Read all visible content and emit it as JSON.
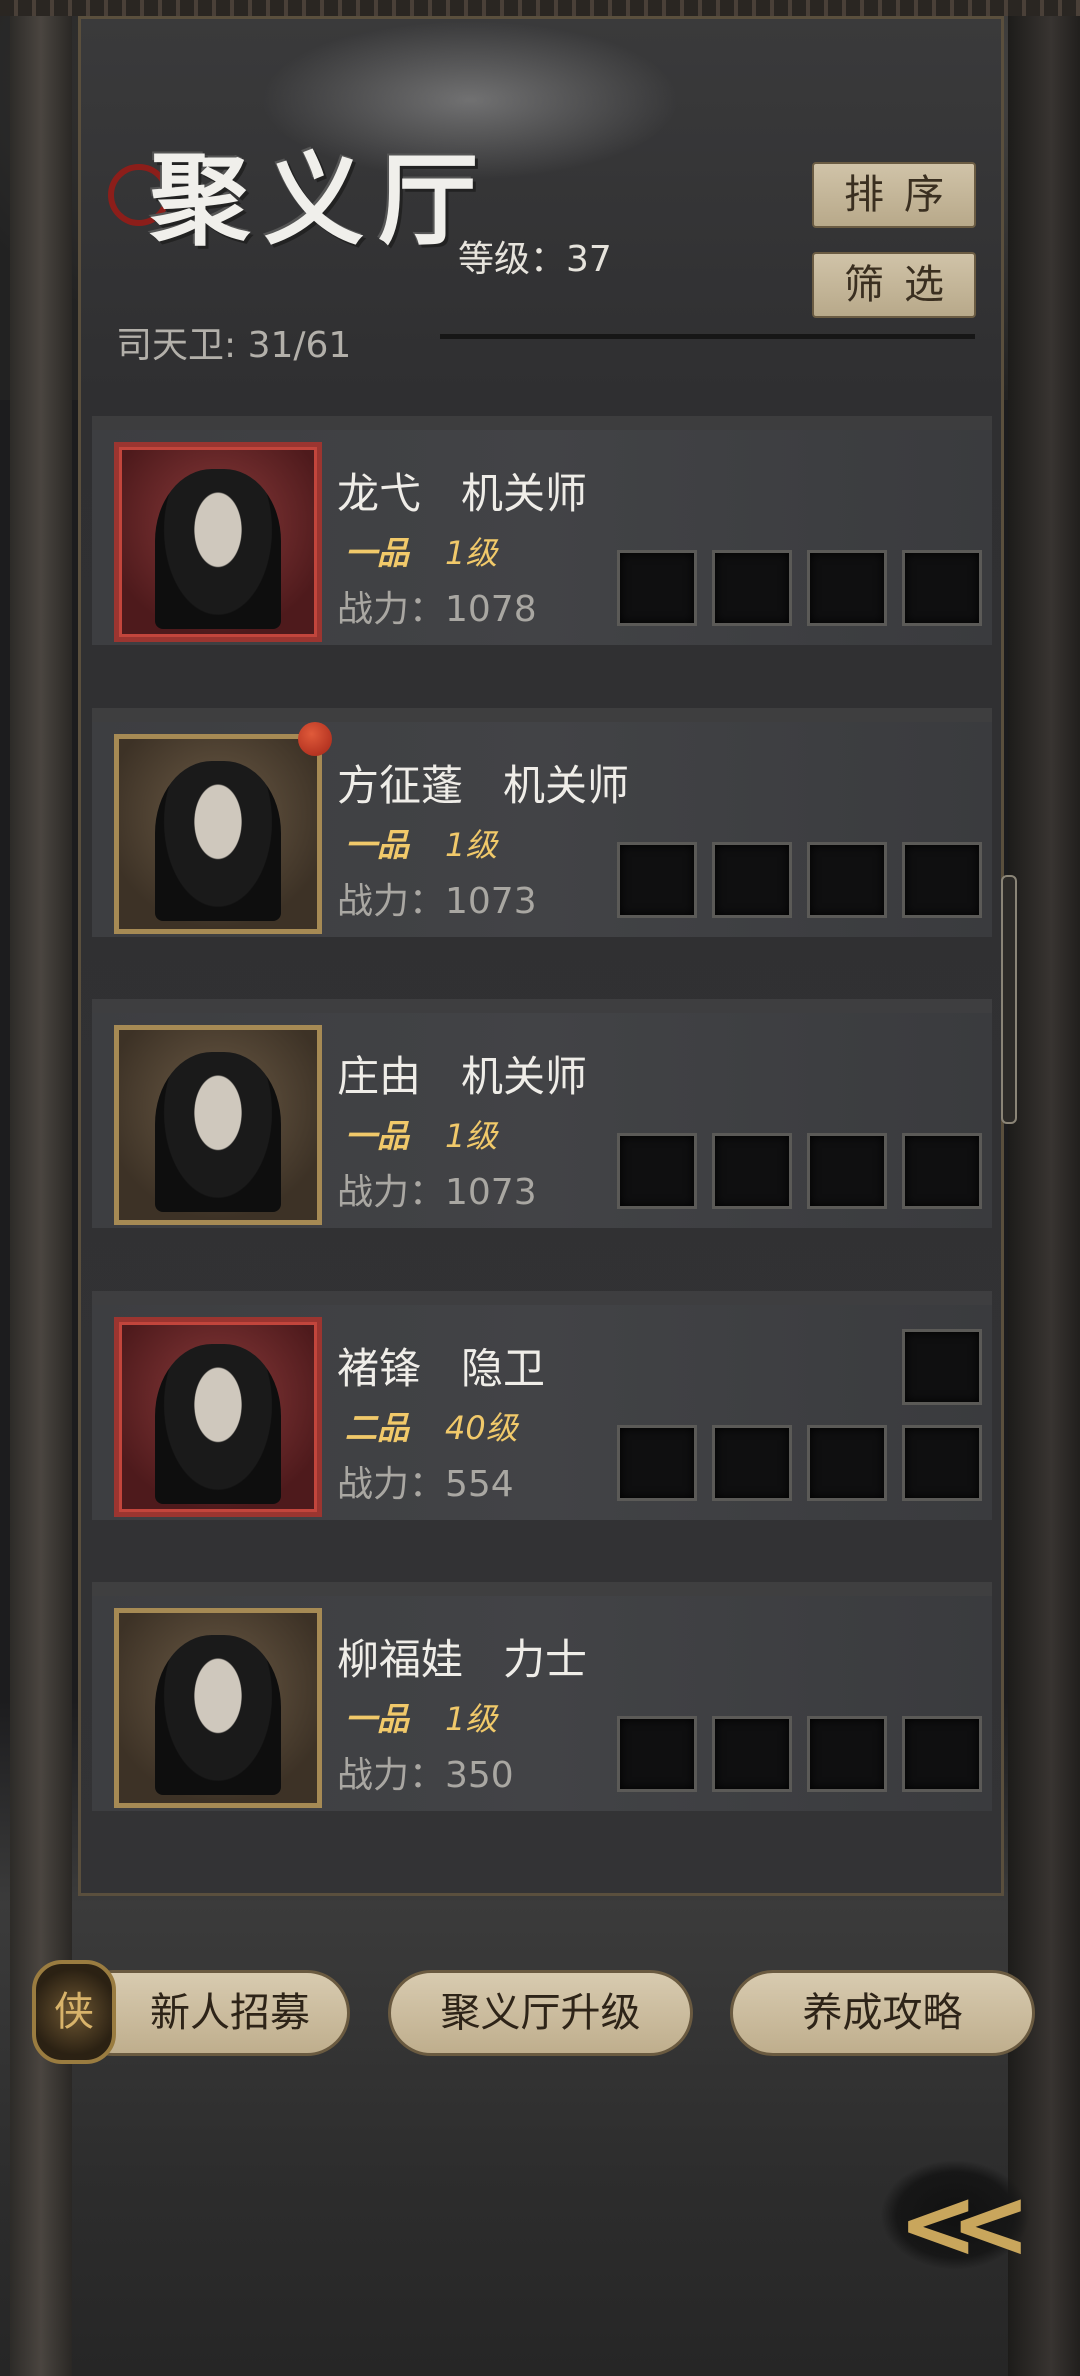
{
  "header": {
    "title": "聚义厅",
    "level_text": "等级：37",
    "guard_text": "司天卫: 31/61",
    "sort_label": "排序",
    "filter_label": "筛选"
  },
  "members": [
    {
      "name": "龙弋   机关师",
      "rank": "一品",
      "grade": "1级",
      "power": "战力：1078",
      "frame": "red",
      "has_dot": false,
      "extra_slot": false
    },
    {
      "name": "方征蓬   机关师",
      "rank": "一品",
      "grade": "1级",
      "power": "战力：1073",
      "frame": "gold",
      "has_dot": true,
      "extra_slot": false
    },
    {
      "name": "庄由   机关师",
      "rank": "一品",
      "grade": "1级",
      "power": "战力：1073",
      "frame": "gold",
      "has_dot": false,
      "extra_slot": false
    },
    {
      "name": "褚锋   隐卫",
      "rank": "二品",
      "grade": "40级",
      "power": "战力：554",
      "frame": "red",
      "has_dot": false,
      "extra_slot": true
    },
    {
      "name": "柳福娃   力士",
      "rank": "一品",
      "grade": "1级",
      "power": "战力：350",
      "frame": "gold",
      "has_dot": false,
      "extra_slot": false
    }
  ],
  "footer": {
    "recruit_badge": "侠",
    "recruit_label": "新人招募",
    "upgrade_label": "聚义厅升级",
    "guide_label": "养成攻略",
    "back_symbol": "<<"
  },
  "colors": {
    "accent_gold": "#f1c96a",
    "button_bg": "#c8b99c",
    "red_frame": "#9b3530",
    "gold_frame": "#a68a54"
  }
}
